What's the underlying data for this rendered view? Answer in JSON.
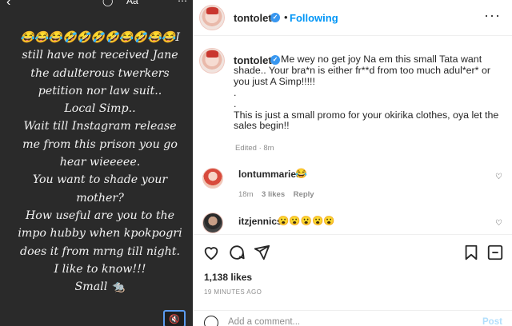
{
  "story": {
    "text": "😂😂😂🤣🤣🤣🤣😂🤣😂😂I still have not received Jane the adulterous twerkers petition nor law suit..\nLocal Simp..\nWait till Instagram release me from this prison you go hear wieeeee.\nYou want to shade your mother?\nHow useful are you to the impo hubby when kpokpogri does it from mrng till night.\nI like to know!!!\nSmall 🐀",
    "top_icon_label": "Aa"
  },
  "post": {
    "username": "tontolet",
    "follow_label": "Following",
    "caption": "Me wey no get joy Na em this small Tata want shade.. Your bra*n is either fr**d from too much adul*er* or you just A Simp!!!!!\n.\n.\nThis is just a small promo for your okirika clothes, oya let the sales begin!!",
    "caption_meta": "Edited · 8m",
    "comments": [
      {
        "username": "lontummarie5",
        "text": "😂",
        "age": "18m",
        "likes": "3 likes",
        "reply": "Reply"
      },
      {
        "username": "itzjennics",
        "text": "😮😮😮😮😮"
      }
    ],
    "likes": "1,138 likes",
    "time_ago": "19 MINUTES AGO",
    "comment_placeholder": "Add a comment...",
    "post_label": "Post"
  },
  "colors": {
    "accent": "#0095f6",
    "verified": "#3897f0",
    "story_bg": "#2a2a2a"
  }
}
